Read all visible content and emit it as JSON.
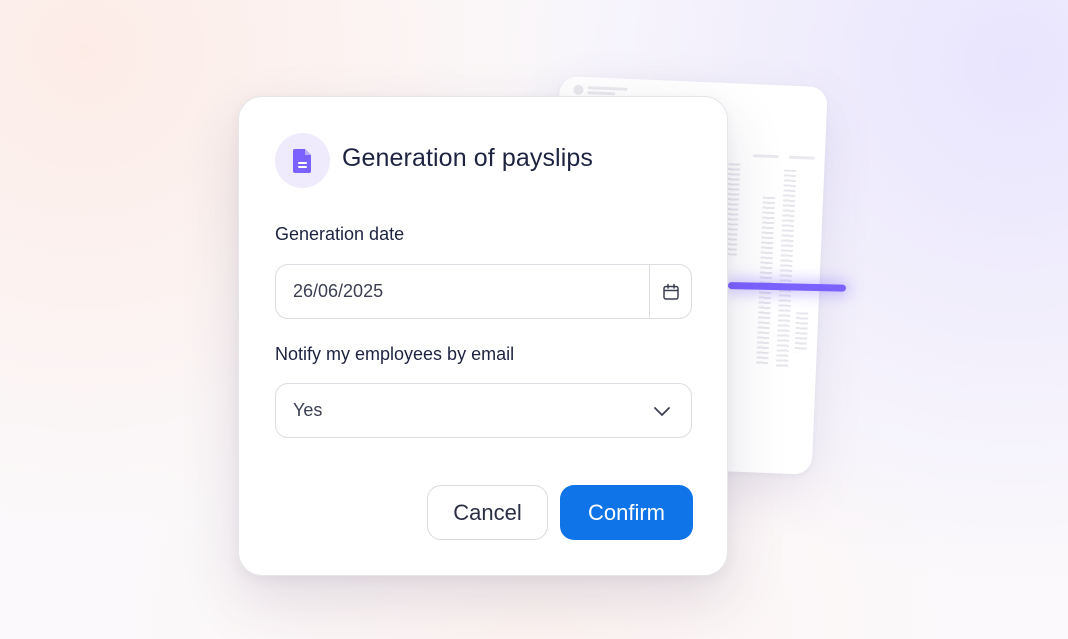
{
  "modal": {
    "title": "Generation of payslips",
    "icon": "document-icon",
    "icon_color": "#7b61ff",
    "date_field": {
      "label": "Generation date",
      "value": "26/06/2025",
      "icon": "calendar-icon"
    },
    "notify_field": {
      "label": "Notify my employees by email",
      "value": "Yes",
      "icon": "chevron-down-icon"
    },
    "buttons": {
      "cancel_label": "Cancel",
      "confirm_label": "Confirm"
    }
  },
  "colors": {
    "accent": "#0f74e8",
    "scan_highlight": "#7b61ff",
    "title_text": "#1d2340"
  }
}
